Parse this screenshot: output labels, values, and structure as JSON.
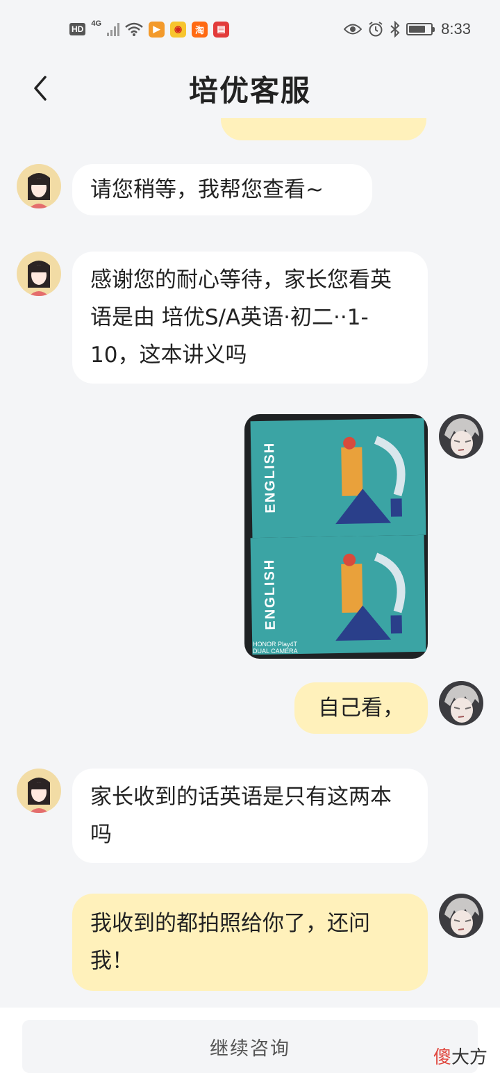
{
  "status_bar": {
    "hd": "HD",
    "network": "4G",
    "time": "8:33",
    "battery_level": 0.75,
    "icons": [
      "wifi-icon",
      "video-app-icon",
      "weibo-icon",
      "taobao-icon",
      "reader-app-icon",
      "eye-icon",
      "alarm-icon",
      "bluetooth-icon",
      "battery-icon"
    ]
  },
  "header": {
    "title": "培优客服",
    "back_icon": "chevron-left-icon"
  },
  "messages": [
    {
      "side": "in",
      "text": "请您稍等，我帮您查看~"
    },
    {
      "side": "in",
      "text": "感谢您的耐心等待，家长您看英语是由 培优S/A英语·初二··1-10，这本讲义吗"
    },
    {
      "side": "out",
      "type": "image",
      "caption": "ENGLISH",
      "watermark": "HONOR Play4T\nDUAL CAMERA"
    },
    {
      "side": "out",
      "text": "自己看，"
    },
    {
      "side": "in",
      "text": "家长收到的话英语是只有这两本吗"
    },
    {
      "side": "out",
      "text": "我收到的都拍照给你了，还问我！"
    }
  ],
  "bottom": {
    "button_label": "继续咨询"
  },
  "brand_watermark": {
    "highlight": "傻",
    "rest": "大方"
  },
  "colors": {
    "outgoing_bubble": "#fff1bb",
    "incoming_bubble": "#ffffff",
    "background": "#f4f5f7",
    "book_teal": "#3ba4a4"
  }
}
